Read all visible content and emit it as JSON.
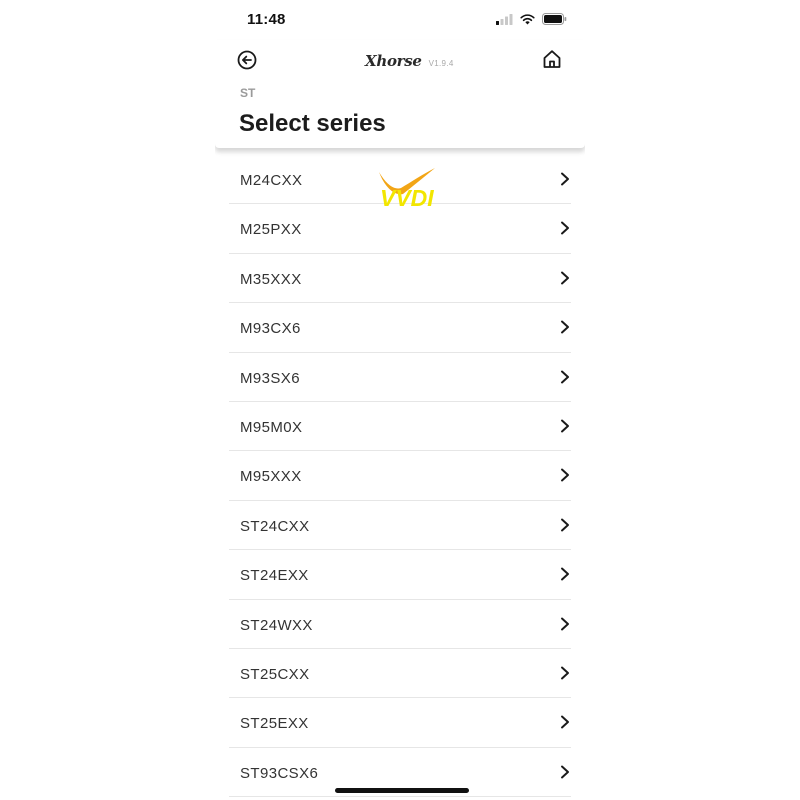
{
  "status_bar": {
    "time": "11:48"
  },
  "header": {
    "logo": "Xhorse",
    "version": "V1.9.4",
    "breadcrumb": "ST",
    "title": "Select series"
  },
  "watermark": {
    "text": "VVDI"
  },
  "series": [
    {
      "label": "M24CXX"
    },
    {
      "label": "M25PXX"
    },
    {
      "label": "M35XXX"
    },
    {
      "label": "M93CX6"
    },
    {
      "label": "M93SX6"
    },
    {
      "label": "M95M0X"
    },
    {
      "label": "M95XXX"
    },
    {
      "label": "ST24CXX"
    },
    {
      "label": "ST24EXX"
    },
    {
      "label": "ST24WXX"
    },
    {
      "label": "ST25CXX"
    },
    {
      "label": "ST25EXX"
    },
    {
      "label": "ST93CSX6"
    }
  ],
  "icons": {
    "back": "back-arrow-icon",
    "home": "home-icon",
    "chevron": "chevron-right-icon"
  },
  "colors": {
    "watermark_yellow": "#f2e600",
    "watermark_orange": "#f2a516"
  }
}
